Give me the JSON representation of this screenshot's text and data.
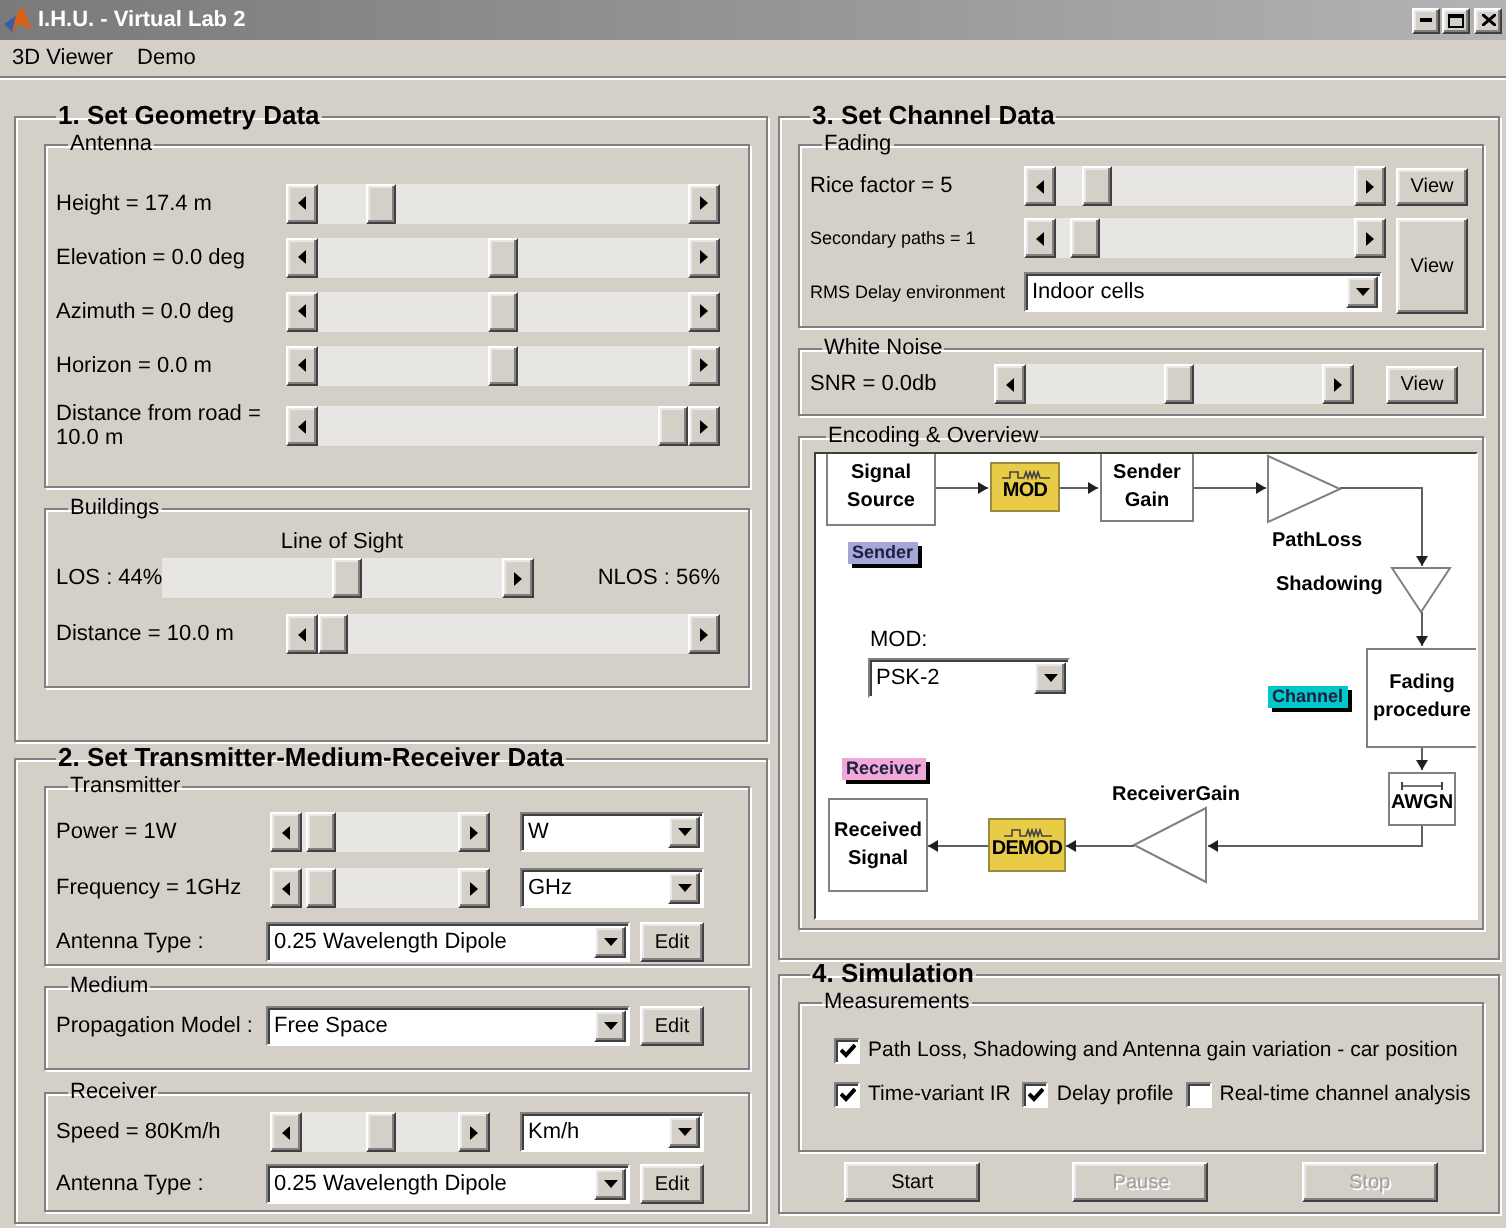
{
  "window": {
    "title": "I.H.U. - Virtual Lab 2"
  },
  "menu": [
    {
      "label": "3D Viewer"
    },
    {
      "label": "Demo"
    }
  ],
  "geometry": {
    "title": "1. Set Geometry Data",
    "antenna": {
      "title": "Antenna",
      "sliders": [
        {
          "label": "Height = 17.4 m",
          "level": 0.14
        },
        {
          "label": "Elevation = 0.0 deg",
          "level": 0.5
        },
        {
          "label": "Azimuth = 0.0 deg",
          "level": 0.5
        },
        {
          "label": "Horizon = 0.0 m",
          "level": 0.5
        },
        {
          "label": "Distance from road = 10.0 m",
          "level": 1
        }
      ]
    },
    "buildings": {
      "title": "Buildings",
      "los": {
        "caption": "Line of Sight",
        "left_label": "LOS : 44%",
        "right_label": "NLOS : 56%",
        "level": 0.55
      },
      "distance": {
        "label": "Distance = 10.0 m",
        "level": 0
      }
    }
  },
  "tmr": {
    "title": "2. Set Transmitter-Medium-Receiver Data",
    "transmitter": {
      "title": "Transmitter",
      "rows": [
        {
          "label": "Power = 1W",
          "level": 0.03,
          "unit": "W"
        },
        {
          "label": "Frequency = 1GHz",
          "level": 0.03,
          "unit": "GHz"
        }
      ],
      "antenna": {
        "label": "Antenna Type :",
        "value": "0.25 Wavelength Dipole",
        "button": "Edit"
      }
    },
    "medium": {
      "title": "Medium",
      "model": {
        "label": "Propagation Model :",
        "value": "Free Space",
        "button": "Edit"
      }
    },
    "receiver": {
      "title": "Receiver",
      "rows": [
        {
          "label": "Speed = 80Km/h",
          "level": 0.5,
          "unit": "Km/h"
        }
      ],
      "antenna": {
        "label": "Antenna Type :",
        "value": "0.25 Wavelength Dipole",
        "button": "Edit"
      }
    }
  },
  "channel": {
    "title": "3. Set Channel Data",
    "fading": {
      "title": "Fading",
      "rice": {
        "label": "Rice factor = 5",
        "level": 0.1,
        "button": "View"
      },
      "paths": {
        "label": "Secondary paths = 1",
        "level": 0.05
      },
      "rms": {
        "label": "RMS Delay environment",
        "value": "Indoor cells"
      },
      "button": "View"
    },
    "noise": {
      "title": "White Noise",
      "snr": {
        "label": "SNR = 0.0db",
        "level": 0.52,
        "button": "View"
      }
    },
    "overview": {
      "title": "Encoding & Overview",
      "diagram": {
        "blocks": [
          {
            "kind": "block",
            "text": "Signal Source"
          },
          {
            "kind": "modulator",
            "text": "MOD"
          },
          {
            "kind": "block",
            "text": "Sender Gain"
          },
          {
            "kind": "block",
            "text": "Fading procedure"
          },
          {
            "kind": "noise",
            "text": "AWGN"
          },
          {
            "kind": "block",
            "text": "Received Signal"
          },
          {
            "kind": "modulator",
            "text": "DEMOD"
          }
        ],
        "gains": [
          {
            "text": "PathLoss",
            "kind": "right"
          },
          {
            "text": "Shadowing",
            "kind": "down"
          },
          {
            "text": "ReceiverGain",
            "kind": "left"
          }
        ],
        "tags": [
          {
            "text": "Sender",
            "color": "#a4a8d8"
          },
          {
            "text": "Channel",
            "color": "#00c8c8"
          },
          {
            "text": "Receiver",
            "color": "#f0a8d8"
          }
        ],
        "mod_select": {
          "label": "MOD:",
          "value": "PSK-2"
        }
      }
    }
  },
  "simulation": {
    "title": "4. Simulation",
    "measurements": {
      "title": "Measurements",
      "options": [
        {
          "label": "Path Loss, Shadowing and Antenna gain variation - car position",
          "checked": true
        },
        {
          "label": "Time-variant IR",
          "checked": true
        },
        {
          "label": "Delay profile",
          "checked": true
        },
        {
          "label": "Real-time channel analysis",
          "checked": false
        }
      ]
    },
    "buttons": [
      {
        "label": "Start",
        "disabled": false
      },
      {
        "label": "Pause",
        "disabled": true
      },
      {
        "label": "Stop",
        "disabled": true
      }
    ]
  }
}
